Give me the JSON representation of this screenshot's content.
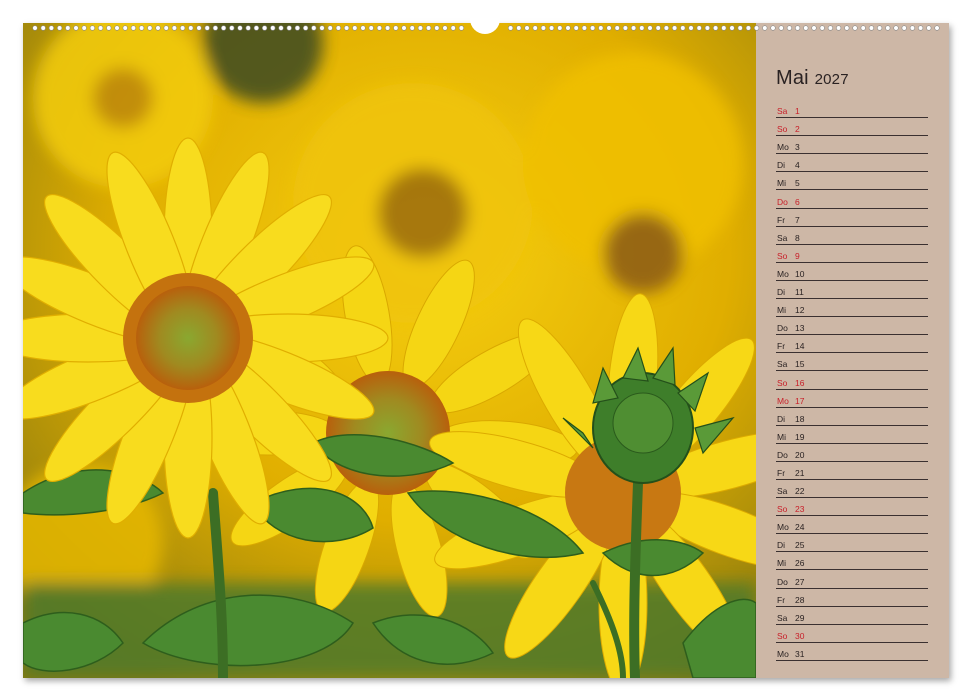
{
  "calendar": {
    "month": "Mai",
    "year": "2027",
    "days": [
      {
        "wd": "Sa",
        "d": "1",
        "red": true
      },
      {
        "wd": "So",
        "d": "2",
        "red": true
      },
      {
        "wd": "Mo",
        "d": "3",
        "red": false
      },
      {
        "wd": "Di",
        "d": "4",
        "red": false
      },
      {
        "wd": "Mi",
        "d": "5",
        "red": false
      },
      {
        "wd": "Do",
        "d": "6",
        "red": true
      },
      {
        "wd": "Fr",
        "d": "7",
        "red": false
      },
      {
        "wd": "Sa",
        "d": "8",
        "red": false
      },
      {
        "wd": "So",
        "d": "9",
        "red": true
      },
      {
        "wd": "Mo",
        "d": "10",
        "red": false
      },
      {
        "wd": "Di",
        "d": "11",
        "red": false
      },
      {
        "wd": "Mi",
        "d": "12",
        "red": false
      },
      {
        "wd": "Do",
        "d": "13",
        "red": false
      },
      {
        "wd": "Fr",
        "d": "14",
        "red": false
      },
      {
        "wd": "Sa",
        "d": "15",
        "red": false
      },
      {
        "wd": "So",
        "d": "16",
        "red": true
      },
      {
        "wd": "Mo",
        "d": "17",
        "red": true
      },
      {
        "wd": "Di",
        "d": "18",
        "red": false
      },
      {
        "wd": "Mi",
        "d": "19",
        "red": false
      },
      {
        "wd": "Do",
        "d": "20",
        "red": false
      },
      {
        "wd": "Fr",
        "d": "21",
        "red": false
      },
      {
        "wd": "Sa",
        "d": "22",
        "red": false
      },
      {
        "wd": "So",
        "d": "23",
        "red": true
      },
      {
        "wd": "Mo",
        "d": "24",
        "red": false
      },
      {
        "wd": "Di",
        "d": "25",
        "red": false
      },
      {
        "wd": "Mi",
        "d": "26",
        "red": false
      },
      {
        "wd": "Do",
        "d": "27",
        "red": false
      },
      {
        "wd": "Fr",
        "d": "28",
        "red": false
      },
      {
        "wd": "Sa",
        "d": "29",
        "red": false
      },
      {
        "wd": "So",
        "d": "30",
        "red": true
      },
      {
        "wd": "Mo",
        "d": "31",
        "red": false
      }
    ]
  },
  "photo": {
    "subject": "sunflowers-photo",
    "colors": {
      "petal": "#f5d20a",
      "center": "#c07a10",
      "leaf": "#3d7a2a",
      "bud": "#2f6e22"
    }
  },
  "colors": {
    "panel": "#cdb7a6",
    "weekend": "#c8202a",
    "text": "#2a2222"
  }
}
